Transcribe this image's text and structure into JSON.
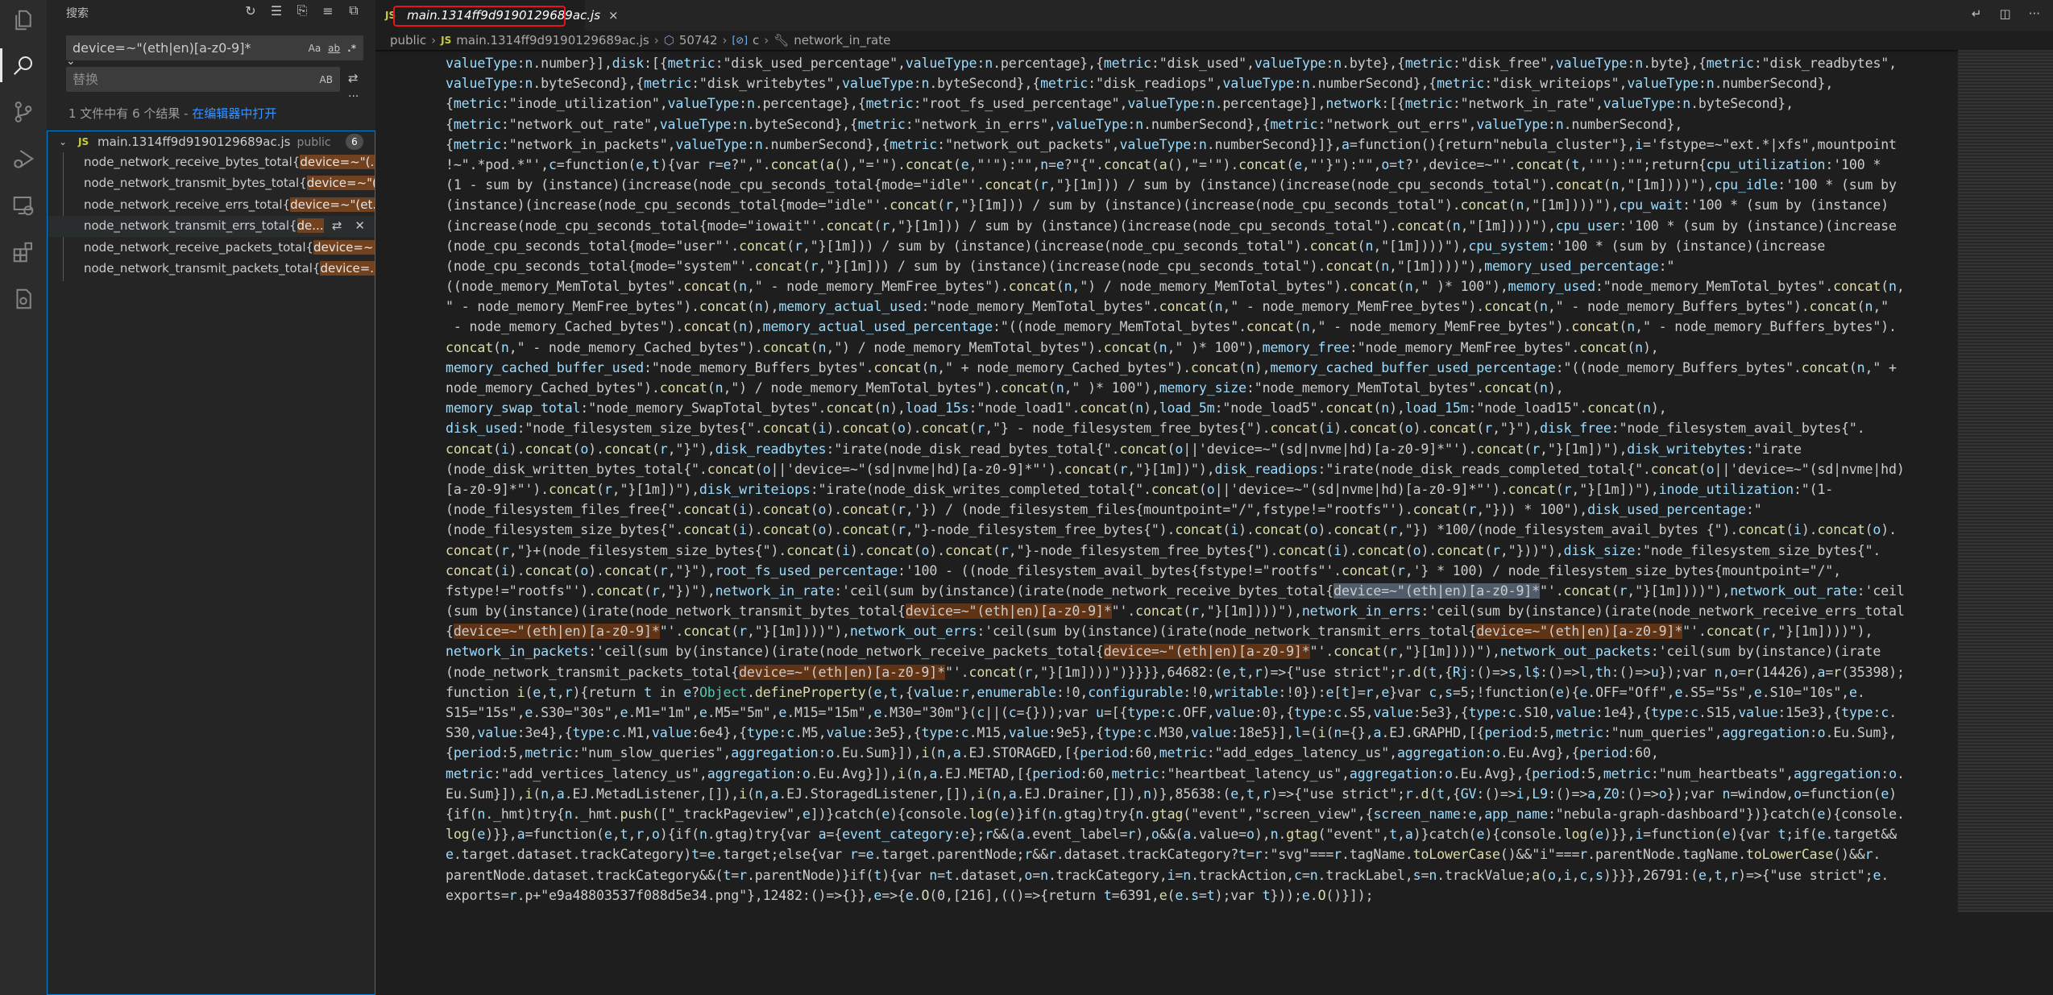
{
  "activity_bar": {
    "items": [
      {
        "name": "explorer",
        "icon": "files-icon"
      },
      {
        "name": "search",
        "icon": "search-icon",
        "active": true
      },
      {
        "name": "source-control",
        "icon": "source-control-icon"
      },
      {
        "name": "run-debug",
        "icon": "debug-icon"
      },
      {
        "name": "remote-explorer",
        "icon": "remote-explorer-icon"
      },
      {
        "name": "extensions",
        "icon": "extensions-icon"
      },
      {
        "name": "testing",
        "icon": "test-icon"
      }
    ]
  },
  "sidebar": {
    "title": "搜索",
    "actions": [
      "refresh-icon",
      "clear-results-icon",
      "new-search-editor-icon",
      "view-as-list-icon",
      "collapse-all-icon"
    ],
    "search_value": "device=~\"(eth|en)[a-z0-9]*",
    "search_options": [
      "Aa",
      "ab",
      ".*"
    ],
    "replace_placeholder": "替换",
    "replace_option": "AB",
    "summary": "1 文件中有 6 个结果 - ",
    "open_in_editor": "在编辑器中打开",
    "file": {
      "badge": "JS",
      "name": "main.1314ff9d9190129689ac.js",
      "path": "public",
      "count": "6"
    },
    "matches": [
      {
        "prefix": "node_network_receive_bytes_total{",
        "match": "device=~\"(..."
      },
      {
        "prefix": "node_network_transmit_bytes_total{",
        "match": "device=~\"(..."
      },
      {
        "prefix": "node_network_receive_errs_total{",
        "match": "device=~\"(et..."
      },
      {
        "prefix": "node_network_transmit_errs_total{",
        "match": "de...",
        "hover": true
      },
      {
        "prefix": "node_network_receive_packets_total{",
        "match": "device=~..."
      },
      {
        "prefix": "node_network_transmit_packets_total{",
        "match": "device=..."
      }
    ]
  },
  "tab": {
    "badge": "JS",
    "title": "main.1314ff9d9190129689ac.js",
    "close": "×"
  },
  "breadcrumb": {
    "folder": "public",
    "badge": "JS",
    "file": "main.1314ff9d9190129689ac.js",
    "module": "50742",
    "variable": "c",
    "property": "network_in_rate"
  },
  "colors": {
    "match_highlight": "#613315",
    "current_match": "#515c6a",
    "annotation_box": "#e8141c",
    "link": "#3794ff"
  },
  "highlight_pattern": "device=~\"(eth|en)[a-z0-9]*",
  "code_lines": [
    "valueType:n.number}],disk:[{metric:\"disk_used_percentage\",valueType:n.percentage},{metric:\"disk_used\",valueType:n.byte},{metric:\"disk_free\",valueType:n.byte},{metric:\"disk_readbytes\",",
    "valueType:n.byteSecond},{metric:\"disk_writebytes\",valueType:n.byteSecond},{metric:\"disk_readiops\",valueType:n.numberSecond},{metric:\"disk_writeiops\",valueType:n.numberSecond},",
    "{metric:\"inode_utilization\",valueType:n.percentage},{metric:\"root_fs_used_percentage\",valueType:n.percentage}],network:[{metric:\"network_in_rate\",valueType:n.byteSecond},",
    "{metric:\"network_out_rate\",valueType:n.byteSecond},{metric:\"network_in_errs\",valueType:n.numberSecond},{metric:\"network_out_errs\",valueType:n.numberSecond},",
    "{metric:\"network_in_packets\",valueType:n.numberSecond},{metric:\"network_out_packets\",valueType:n.numberSecond}]},a=function(){return\"nebula_cluster\"},i='fstype=~\"ext.*|xfs\",mountpoint",
    "!~\".*pod.*\"',c=function(e,t){var r=e?\",\".concat(a(),\"='\").concat(e,\"'\"):\"\",n=e?\"{\".concat(a(),\"='\").concat(e,\"'}\"):\"\",o=t?',device=~\"'.concat(t,'\"'):\"\";return{cpu_utilization:'100 *",
    "(1 - sum by (instance)(increase(node_cpu_seconds_total{mode=\"idle\"'.concat(r,\"}[1m])) / sum by (instance)(increase(node_cpu_seconds_total\").concat(n,\"[1m])))\"),cpu_idle:'100 * (sum by",
    "(instance)(increase(node_cpu_seconds_total{mode=\"idle\"'.concat(r,\"}[1m])) / sum by (instance)(increase(node_cpu_seconds_total\").concat(n,\"[1m])))\"),cpu_wait:'100 * (sum by (instance)",
    "(increase(node_cpu_seconds_total{mode=\"iowait\"'.concat(r,\"}[1m])) / sum by (instance)(increase(node_cpu_seconds_total\").concat(n,\"[1m])))\"),cpu_user:'100 * (sum by (instance)(increase",
    "(node_cpu_seconds_total{mode=\"user\"'.concat(r,\"}[1m])) / sum by (instance)(increase(node_cpu_seconds_total\").concat(n,\"[1m])))\"),cpu_system:'100 * (sum by (instance)(increase",
    "(node_cpu_seconds_total{mode=\"system\"'.concat(r,\"}[1m])) / sum by (instance)(increase(node_cpu_seconds_total\").concat(n,\"[1m])))\"),memory_used_percentage:\"",
    "((node_memory_MemTotal_bytes\".concat(n,\" - node_memory_MemFree_bytes\").concat(n,\") / node_memory_MemTotal_bytes\").concat(n,\" )* 100\"),memory_used:\"node_memory_MemTotal_bytes\".concat(n,",
    "\" - node_memory_MemFree_bytes\").concat(n),memory_actual_used:\"node_memory_MemTotal_bytes\".concat(n,\" - node_memory_MemFree_bytes\").concat(n,\" - node_memory_Buffers_bytes\").concat(n,\"",
    " - node_memory_Cached_bytes\").concat(n),memory_actual_used_percentage:\"((node_memory_MemTotal_bytes\".concat(n,\" - node_memory_MemFree_bytes\").concat(n,\" - node_memory_Buffers_bytes\").",
    "concat(n,\" - node_memory_Cached_bytes\").concat(n,\") / node_memory_MemTotal_bytes\").concat(n,\" )* 100\"),memory_free:\"node_memory_MemFree_bytes\".concat(n),",
    "memory_cached_buffer_used:\"node_memory_Buffers_bytes\".concat(n,\" + node_memory_Cached_bytes\").concat(n),memory_cached_buffer_used_percentage:\"((node_memory_Buffers_bytes\".concat(n,\" +",
    "node_memory_Cached_bytes\").concat(n,\") / node_memory_MemTotal_bytes\").concat(n,\" )* 100\"),memory_size:\"node_memory_MemTotal_bytes\".concat(n),",
    "memory_swap_total:\"node_memory_SwapTotal_bytes\".concat(n),load_15s:\"node_load1\".concat(n),load_5m:\"node_load5\".concat(n),load_15m:\"node_load15\".concat(n),",
    "disk_used:\"node_filesystem_size_bytes{\".concat(i).concat(o).concat(r,\"} - node_filesystem_free_bytes{\").concat(i).concat(o).concat(r,\"}\"),disk_free:\"node_filesystem_avail_bytes{\".",
    "concat(i).concat(o).concat(r,\"}\"),disk_readbytes:\"irate(node_disk_read_bytes_total{\".concat(o||'device=~\"(sd|nvme|hd)[a-z0-9]*\"').concat(r,\"}[1m])\"),disk_writebytes:\"irate",
    "(node_disk_written_bytes_total{\".concat(o||'device=~\"(sd|nvme|hd)[a-z0-9]*\"').concat(r,\"}[1m])\"),disk_readiops:\"irate(node_disk_reads_completed_total{\".concat(o||'device=~\"(sd|nvme|hd)",
    "[a-z0-9]*\"').concat(r,\"}[1m])\"),disk_writeiops:\"irate(node_disk_writes_completed_total{\".concat(o||'device=~\"(sd|nvme|hd)[a-z0-9]*\"').concat(r,\"}[1m])\"),inode_utilization:\"(1-",
    "(node_filesystem_files_free{\".concat(i).concat(o).concat(r,'}) / (node_filesystem_files{mountpoint=\"/\",fstype!=\"rootfs\"').concat(r,\"})) * 100\"),disk_used_percentage:\"",
    "(node_filesystem_size_bytes{\".concat(i).concat(o).concat(r,\"}-node_filesystem_free_bytes{\").concat(i).concat(o).concat(r,\"}) *100/(node_filesystem_avail_bytes {\").concat(i).concat(o).",
    "concat(r,\"}+(node_filesystem_size_bytes{\").concat(i).concat(o).concat(r,\"}-node_filesystem_free_bytes{\").concat(i).concat(o).concat(r,\"}))\"),disk_size:\"node_filesystem_size_bytes{\".",
    "concat(i).concat(o).concat(r,\"}\"),root_fs_used_percentage:'100 - ((node_filesystem_avail_bytes{fstype!=\"rootfs\"'.concat(r,'} * 100) / node_filesystem_size_bytes{mountpoint=\"/\",",
    "fstype!=\"rootfs\"').concat(r,\"})\"),network_in_rate:'ceil(sum by(instance)(irate(node_network_receive_bytes_total{device=~\"(eth|en)[a-z0-9]*\"'.concat(r,\"}[1m])))\"),network_out_rate:'ceil",
    "(sum by(instance)(irate(node_network_transmit_bytes_total{device=~\"(eth|en)[a-z0-9]*\"'.concat(r,\"}[1m])))\"),network_in_errs:'ceil(sum by(instance)(irate(node_network_receive_errs_total",
    "{device=~\"(eth|en)[a-z0-9]*\"'.concat(r,\"}[1m])))\"),network_out_errs:'ceil(sum by(instance)(irate(node_network_transmit_errs_total{device=~\"(eth|en)[a-z0-9]*\"'.concat(r,\"}[1m])))\"),",
    "network_in_packets:'ceil(sum by(instance)(irate(node_network_receive_packets_total{device=~\"(eth|en)[a-z0-9]*\"'.concat(r,\"}[1m])))\"),network_out_packets:'ceil(sum by(instance)(irate",
    "(node_network_transmit_packets_total{device=~\"(eth|en)[a-z0-9]*\"'.concat(r,\"}[1m])))\")}}}},64682:(e,t,r)=>{\"use strict\";r.d(t,{Rj:()=>s,l$:()=>l,th:()=>u});var n,o=r(14426),a=r(35398);",
    "function i(e,t,r){return t in e?Object.defineProperty(e,t,{value:r,enumerable:!0,configurable:!0,writable:!0}):e[t]=r,e}var c,s=5;!function(e){e.OFF=\"Off\",e.S5=\"5s\",e.S10=\"10s\",e.",
    "S15=\"15s\",e.S30=\"30s\",e.M1=\"1m\",e.M5=\"5m\",e.M15=\"15m\",e.M30=\"30m\"}(c||(c={}));var u=[{type:c.OFF,value:0},{type:c.S5,value:5e3},{type:c.S10,value:1e4},{type:c.S15,value:15e3},{type:c.",
    "S30,value:3e4},{type:c.M1,value:6e4},{type:c.M5,value:3e5},{type:c.M15,value:9e5},{type:c.M30,value:18e5}],l=(i(n={},a.EJ.GRAPHD,[{period:5,metric:\"num_queries\",aggregation:o.Eu.Sum},",
    "{period:5,metric:\"num_slow_queries\",aggregation:o.Eu.Sum}]),i(n,a.EJ.STORAGED,[{period:60,metric:\"add_edges_latency_us\",aggregation:o.Eu.Avg},{period:60,",
    "metric:\"add_vertices_latency_us\",aggregation:o.Eu.Avg}]),i(n,a.EJ.METAD,[{period:60,metric:\"heartbeat_latency_us\",aggregation:o.Eu.Avg},{period:5,metric:\"num_heartbeats\",aggregation:o.",
    "Eu.Sum}]),i(n,a.EJ.MetadListener,[]),i(n,a.EJ.StoragedListener,[]),i(n,a.EJ.Drainer,[]),n)},85638:(e,t,r)=>{\"use strict\";r.d(t,{GV:()=>i,L9:()=>a,Z0:()=>o});var n=window,o=function(e)",
    "{if(n._hmt)try{n._hmt.push([\"_trackPageview\",e])}catch(e){console.log(e)}if(n.gtag)try{n.gtag(\"event\",\"screen_view\",{screen_name:e,app_name:\"nebula-graph-dashboard\"})}catch(e){console.",
    "log(e)}},a=function(e,t,r,o){if(n.gtag)try{var a={event_category:e};r&&(a.event_label=r),o&&(a.value=o),n.gtag(\"event\",t,a)}catch(e){console.log(e)}},i=function(e){var t;if(e.target&&",
    "e.target.dataset.trackCategory)t=e.target;else{var r=e.target.parentNode;r&&r.dataset.trackCategory?t=r:\"svg\"===r.tagName.toLowerCase()&&\"i\"===r.parentNode.tagName.toLowerCase()&&r.",
    "parentNode.dataset.trackCategory&&(t=r.parentNode)}if(t){var n=t.dataset,o=n.trackCategory,i=n.trackAction,c=n.trackLabel,s=n.trackValue;a(o,i,c,s)}}},26791:(e,t,r)=>{\"use strict\";e.",
    "exports=r.p+\"e9a48803537f088d5e34.png\"},12482:()=>{}},e=>{e.O(0,[216],(()=>{return t=6391,e(e.s=t);var t}));e.O()}]);"
  ]
}
